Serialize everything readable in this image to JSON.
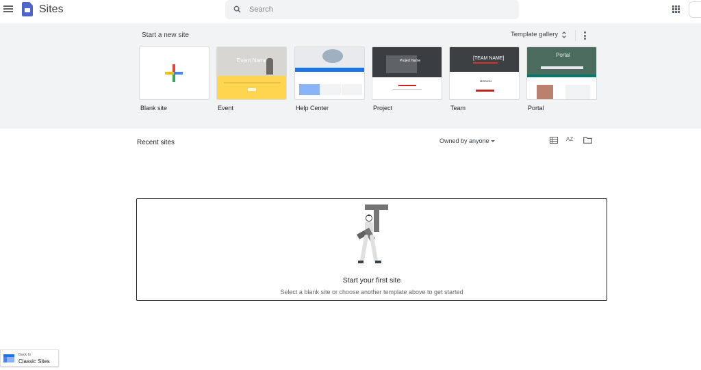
{
  "header": {
    "app_title": "Sites",
    "search_placeholder": "Search"
  },
  "templates_section": {
    "title": "Start a new site",
    "gallery_label": "Template gallery",
    "templates": [
      {
        "label": "Blank site"
      },
      {
        "label": "Event",
        "thumb_text": "Event Name"
      },
      {
        "label": "Help Center"
      },
      {
        "label": "Project",
        "thumb_text": "Project Name"
      },
      {
        "label": "Team",
        "thumb_text": "[TEAM NAME]",
        "thumb_sub": "MISSION"
      },
      {
        "label": "Portal",
        "thumb_text": "Portal"
      }
    ]
  },
  "recent": {
    "title": "Recent sites",
    "owner_filter": "Owned by anyone",
    "sort_icon_text": "AZ",
    "empty_title": "Start your first site",
    "empty_subtitle": "Select a blank site or choose another template above to get started"
  },
  "classic": {
    "small": "Back to",
    "big": "Classic Sites"
  },
  "colors": {
    "band_bg": "#f1f3f4",
    "brand": "#4f64c8",
    "accent_blue": "#1a73e8"
  }
}
